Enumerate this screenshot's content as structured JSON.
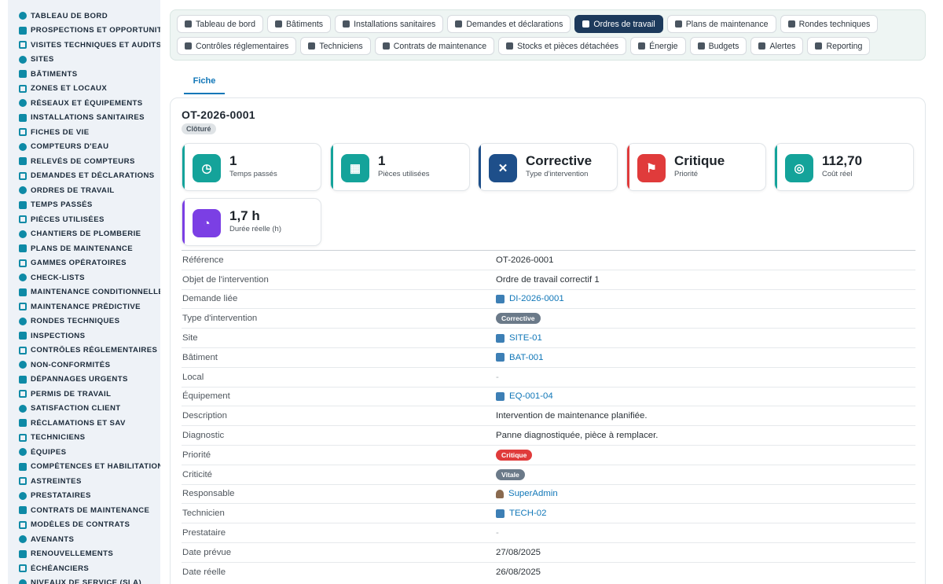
{
  "sidebar": {
    "items": [
      {
        "label": "Tableau de bord",
        "icon": "dashboard-icon"
      },
      {
        "label": "Prospections et opportunités",
        "icon": "target-icon"
      },
      {
        "label": "Visites techniques et audits",
        "icon": "visit-icon"
      },
      {
        "label": "Sites",
        "icon": "pin-icon"
      },
      {
        "label": "Bâtiments",
        "icon": "building-icon"
      },
      {
        "label": "Zones et locaux",
        "icon": "zone-icon"
      },
      {
        "label": "Réseaux et équipements",
        "icon": "network-icon"
      },
      {
        "label": "Installations sanitaires",
        "icon": "cogs-icon"
      },
      {
        "label": "Fiches de vie",
        "icon": "history-icon"
      },
      {
        "label": "Compteurs d'eau",
        "icon": "gauge-icon"
      },
      {
        "label": "Relevés de compteurs",
        "icon": "reading-icon"
      },
      {
        "label": "Demandes et déclarations",
        "icon": "question-icon"
      },
      {
        "label": "Ordres de travail",
        "icon": "clipboard-icon"
      },
      {
        "label": "Temps passés",
        "icon": "clock-icon"
      },
      {
        "label": "Pièces utilisées",
        "icon": "parts-icon"
      },
      {
        "label": "Chantiers de plomberie",
        "icon": "hammer-icon"
      },
      {
        "label": "Plans de maintenance",
        "icon": "calendar-icon"
      },
      {
        "label": "Gammes opératoires",
        "icon": "list-icon"
      },
      {
        "label": "Check-lists",
        "icon": "checklist-icon"
      },
      {
        "label": "Maintenance conditionnelle",
        "icon": "thermometer-icon"
      },
      {
        "label": "Maintenance prédictive",
        "icon": "chart-icon"
      },
      {
        "label": "Rondes techniques",
        "icon": "route-icon"
      },
      {
        "label": "Inspections",
        "icon": "search-icon"
      },
      {
        "label": "Contrôles réglementaires",
        "icon": "check-icon"
      },
      {
        "label": "Non-conformités",
        "icon": "alert-icon"
      },
      {
        "label": "Dépannages urgents",
        "icon": "warning-icon"
      },
      {
        "label": "Permis de travail",
        "icon": "permit-icon"
      },
      {
        "label": "Satisfaction client",
        "icon": "smile-icon"
      },
      {
        "label": "Réclamations et SAV",
        "icon": "chat-icon"
      },
      {
        "label": "Techniciens",
        "icon": "helmet-icon"
      },
      {
        "label": "Équipes",
        "icon": "users-icon"
      },
      {
        "label": "Compétences et habilitations",
        "icon": "award-icon"
      },
      {
        "label": "Astreintes",
        "icon": "phone-icon"
      },
      {
        "label": "Prestataires",
        "icon": "handshake-icon"
      },
      {
        "label": "Contrats de maintenance",
        "icon": "contract-icon"
      },
      {
        "label": "Modèles de contrats",
        "icon": "template-icon"
      },
      {
        "label": "Avenants",
        "icon": "edit-icon"
      },
      {
        "label": "Renouvellements",
        "icon": "refresh-icon"
      },
      {
        "label": "Échéanciers",
        "icon": "schedule-icon"
      },
      {
        "label": "Niveaux de service (SLA)",
        "icon": "sla-icon"
      }
    ]
  },
  "tabs": {
    "row1": [
      {
        "label": "Tableau de bord",
        "icon": "dashboard-icon",
        "active": false
      },
      {
        "label": "Bâtiments",
        "icon": "building-icon",
        "active": false
      },
      {
        "label": "Installations sanitaires",
        "icon": "cogs-icon",
        "active": false
      },
      {
        "label": "Demandes et déclarations",
        "icon": "question-icon",
        "active": false
      },
      {
        "label": "Ordres de travail",
        "icon": "clipboard-icon",
        "active": true
      },
      {
        "label": "Plans de maintenance",
        "icon": "calendar-icon",
        "active": false
      },
      {
        "label": "Rondes techniques",
        "icon": "route-icon",
        "active": false
      }
    ],
    "row2": [
      {
        "label": "Contrôles réglementaires",
        "icon": "check-icon",
        "active": false
      },
      {
        "label": "Techniciens",
        "icon": "helmet-icon",
        "active": false
      },
      {
        "label": "Contrats de maintenance",
        "icon": "contract-icon",
        "active": false
      },
      {
        "label": "Stocks et pièces détachées",
        "icon": "boxes-icon",
        "active": false
      },
      {
        "label": "Énergie",
        "icon": "bolt-icon",
        "active": false
      },
      {
        "label": "Budgets",
        "icon": "money-icon",
        "active": false
      },
      {
        "label": "Alertes",
        "icon": "bell-icon",
        "active": false
      },
      {
        "label": "Reporting",
        "icon": "pie-icon",
        "active": false
      }
    ]
  },
  "subtab": {
    "label": "Fiche"
  },
  "record": {
    "title": "OT-2026-0001",
    "status": "Clôturé"
  },
  "kpis": [
    {
      "value": "1",
      "label": "Temps passés",
      "color": "#14a39a",
      "icon": "clock-icon",
      "glyph": "◷"
    },
    {
      "value": "1",
      "label": "Pièces utilisées",
      "color": "#14a39a",
      "icon": "boxes-icon",
      "glyph": "▦"
    },
    {
      "value": "Corrective",
      "label": "Type d'intervention",
      "color": "#1e4f8a",
      "icon": "tools-icon",
      "glyph": "✕"
    },
    {
      "value": "Critique",
      "label": "Priorité",
      "color": "#e03b3b",
      "icon": "flag-icon",
      "glyph": "⚑"
    },
    {
      "value": "112,70",
      "label": "Coût réel",
      "color": "#14a39a",
      "icon": "coins-icon",
      "glyph": "◎"
    },
    {
      "value": "1,7 h",
      "label": "Durée réelle (h)",
      "color": "#7b3fe4",
      "icon": "stopwatch-icon",
      "glyph": "◔"
    }
  ],
  "details": [
    {
      "label": "Référence",
      "value": "OT-2026-0001",
      "type": "text"
    },
    {
      "label": "Objet de l'intervention",
      "value": "Ordre de travail correctif 1",
      "type": "text"
    },
    {
      "label": "Demande liée",
      "value": "DI-2026-0001",
      "type": "link"
    },
    {
      "label": "Type d'intervention",
      "value": "Corrective",
      "type": "pill",
      "color": "#6b7a89"
    },
    {
      "label": "Site",
      "value": "SITE-01",
      "type": "link"
    },
    {
      "label": "Bâtiment",
      "value": "BAT-001",
      "type": "link"
    },
    {
      "label": "Local",
      "value": "-",
      "type": "dash"
    },
    {
      "label": "Équipement",
      "value": "EQ-001-04",
      "type": "link"
    },
    {
      "label": "Description",
      "value": "Intervention de maintenance planifiée.",
      "type": "text"
    },
    {
      "label": "Diagnostic",
      "value": "Panne diagnostiquée, pièce à remplacer.",
      "type": "text"
    },
    {
      "label": "Priorité",
      "value": "Critique",
      "type": "pill",
      "color": "#e03b3b"
    },
    {
      "label": "Criticité",
      "value": "Vitale",
      "type": "pill",
      "color": "#6b7a89"
    },
    {
      "label": "Responsable",
      "value": "SuperAdmin",
      "type": "user"
    },
    {
      "label": "Technicien",
      "value": "TECH-02",
      "type": "link"
    },
    {
      "label": "Prestataire",
      "value": "-",
      "type": "dash"
    },
    {
      "label": "Date prévue",
      "value": "27/08/2025",
      "type": "text"
    },
    {
      "label": "Date réelle",
      "value": "26/08/2025",
      "type": "text"
    }
  ]
}
